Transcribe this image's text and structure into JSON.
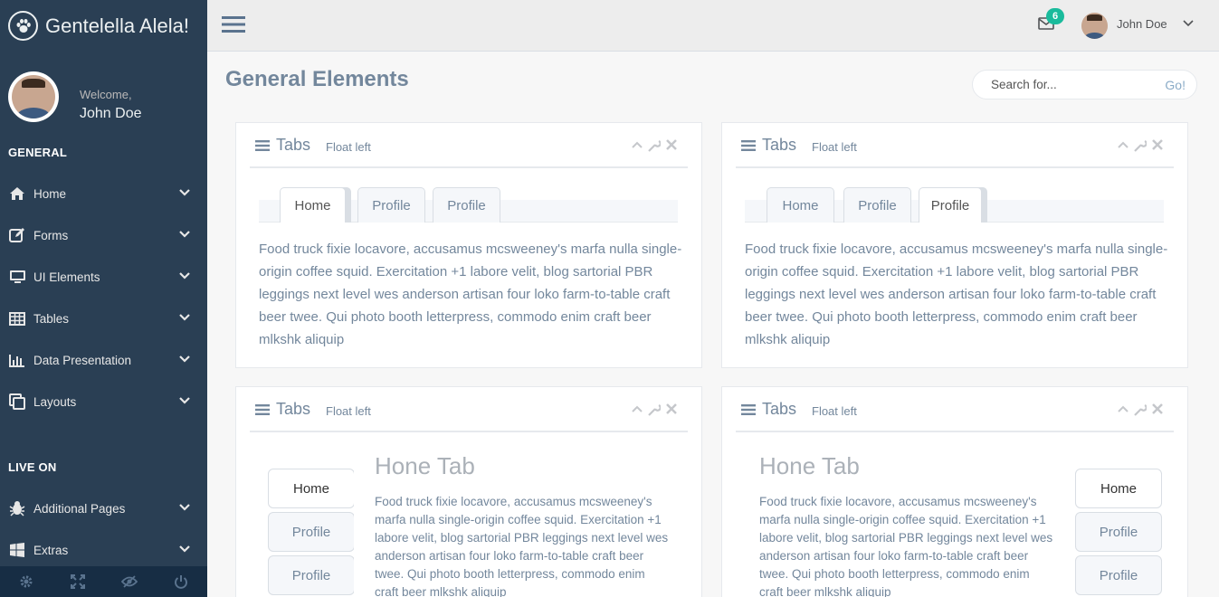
{
  "brand": {
    "title": "Gentelella Alela!",
    "logo_icon": "paw-icon"
  },
  "profile": {
    "welcome": "Welcome,",
    "name": "John Doe"
  },
  "sidebar": {
    "section_general": "GENERAL",
    "general_items": [
      {
        "label": "Home",
        "icon": "home-icon"
      },
      {
        "label": "Forms",
        "icon": "edit-icon"
      },
      {
        "label": "UI Elements",
        "icon": "desktop-icon"
      },
      {
        "label": "Tables",
        "icon": "table-icon"
      },
      {
        "label": "Data Presentation",
        "icon": "bar-chart-icon"
      },
      {
        "label": "Layouts",
        "icon": "clone-icon"
      }
    ],
    "section_live": "LIVE ON",
    "live_items": [
      {
        "label": "Additional Pages",
        "icon": "bug-icon"
      },
      {
        "label": "Extras",
        "icon": "windows-icon"
      }
    ],
    "footer": [
      "gear-icon",
      "fullscreen-icon",
      "eye-slash-icon",
      "power-icon"
    ]
  },
  "topnav": {
    "notifications_count": "6",
    "user_name": "John Doe"
  },
  "page": {
    "title": "General Elements",
    "search_placeholder": "Search for...",
    "search_button": "Go!"
  },
  "panels": [
    {
      "title": "Tabs",
      "subtitle": "Float left",
      "tabs": [
        "Home",
        "Profile",
        "Profile"
      ],
      "active_tab": 0,
      "text": "Food truck fixie locavore, accusamus mcsweeney's marfa nulla single-origin coffee squid. Exercitation +1 labore velit, blog sartorial PBR leggings next level wes anderson artisan four loko farm-to-table craft beer twee. Qui photo booth letterpress, commodo enim craft beer mlkshk aliquip"
    },
    {
      "title": "Tabs",
      "subtitle": "Float left",
      "tabs": [
        "Home",
        "Profile",
        "Profile"
      ],
      "active_tab": 2,
      "text": "Food truck fixie locavore, accusamus mcsweeney's marfa nulla single-origin coffee squid. Exercitation +1 labore velit, blog sartorial PBR leggings next level wes anderson artisan four loko farm-to-table craft beer twee. Qui photo booth letterpress, commodo enim craft beer mlkshk aliquip"
    },
    {
      "title": "Tabs",
      "subtitle": "Float left",
      "tabs": [
        "Home",
        "Profile",
        "Profile"
      ],
      "active_tab": 0,
      "content_title": "Hone Tab",
      "text": "Food truck fixie locavore, accusamus mcsweeney's marfa nulla single-origin coffee squid. Exercitation +1 labore velit, blog sartorial PBR leggings next level wes anderson artisan four loko farm-to-table craft beer twee. Qui photo booth letterpress, commodo enim craft beer mlkshk aliquip"
    },
    {
      "title": "Tabs",
      "subtitle": "Float left",
      "tabs": [
        "Home",
        "Profile",
        "Profile"
      ],
      "active_tab": 0,
      "content_title": "Hone Tab",
      "text": "Food truck fixie locavore, accusamus mcsweeney's marfa nulla single-origin coffee squid. Exercitation +1 labore velit, blog sartorial PBR leggings next level wes anderson artisan four loko farm-to-table craft beer twee. Qui photo booth letterpress, commodo enim craft beer mlkshk aliquip"
    }
  ],
  "colors": {
    "sidebar": "#2A3F54",
    "sidebar_footer": "#172D44",
    "badge": "#1ABB9C",
    "text": "#73879C"
  }
}
